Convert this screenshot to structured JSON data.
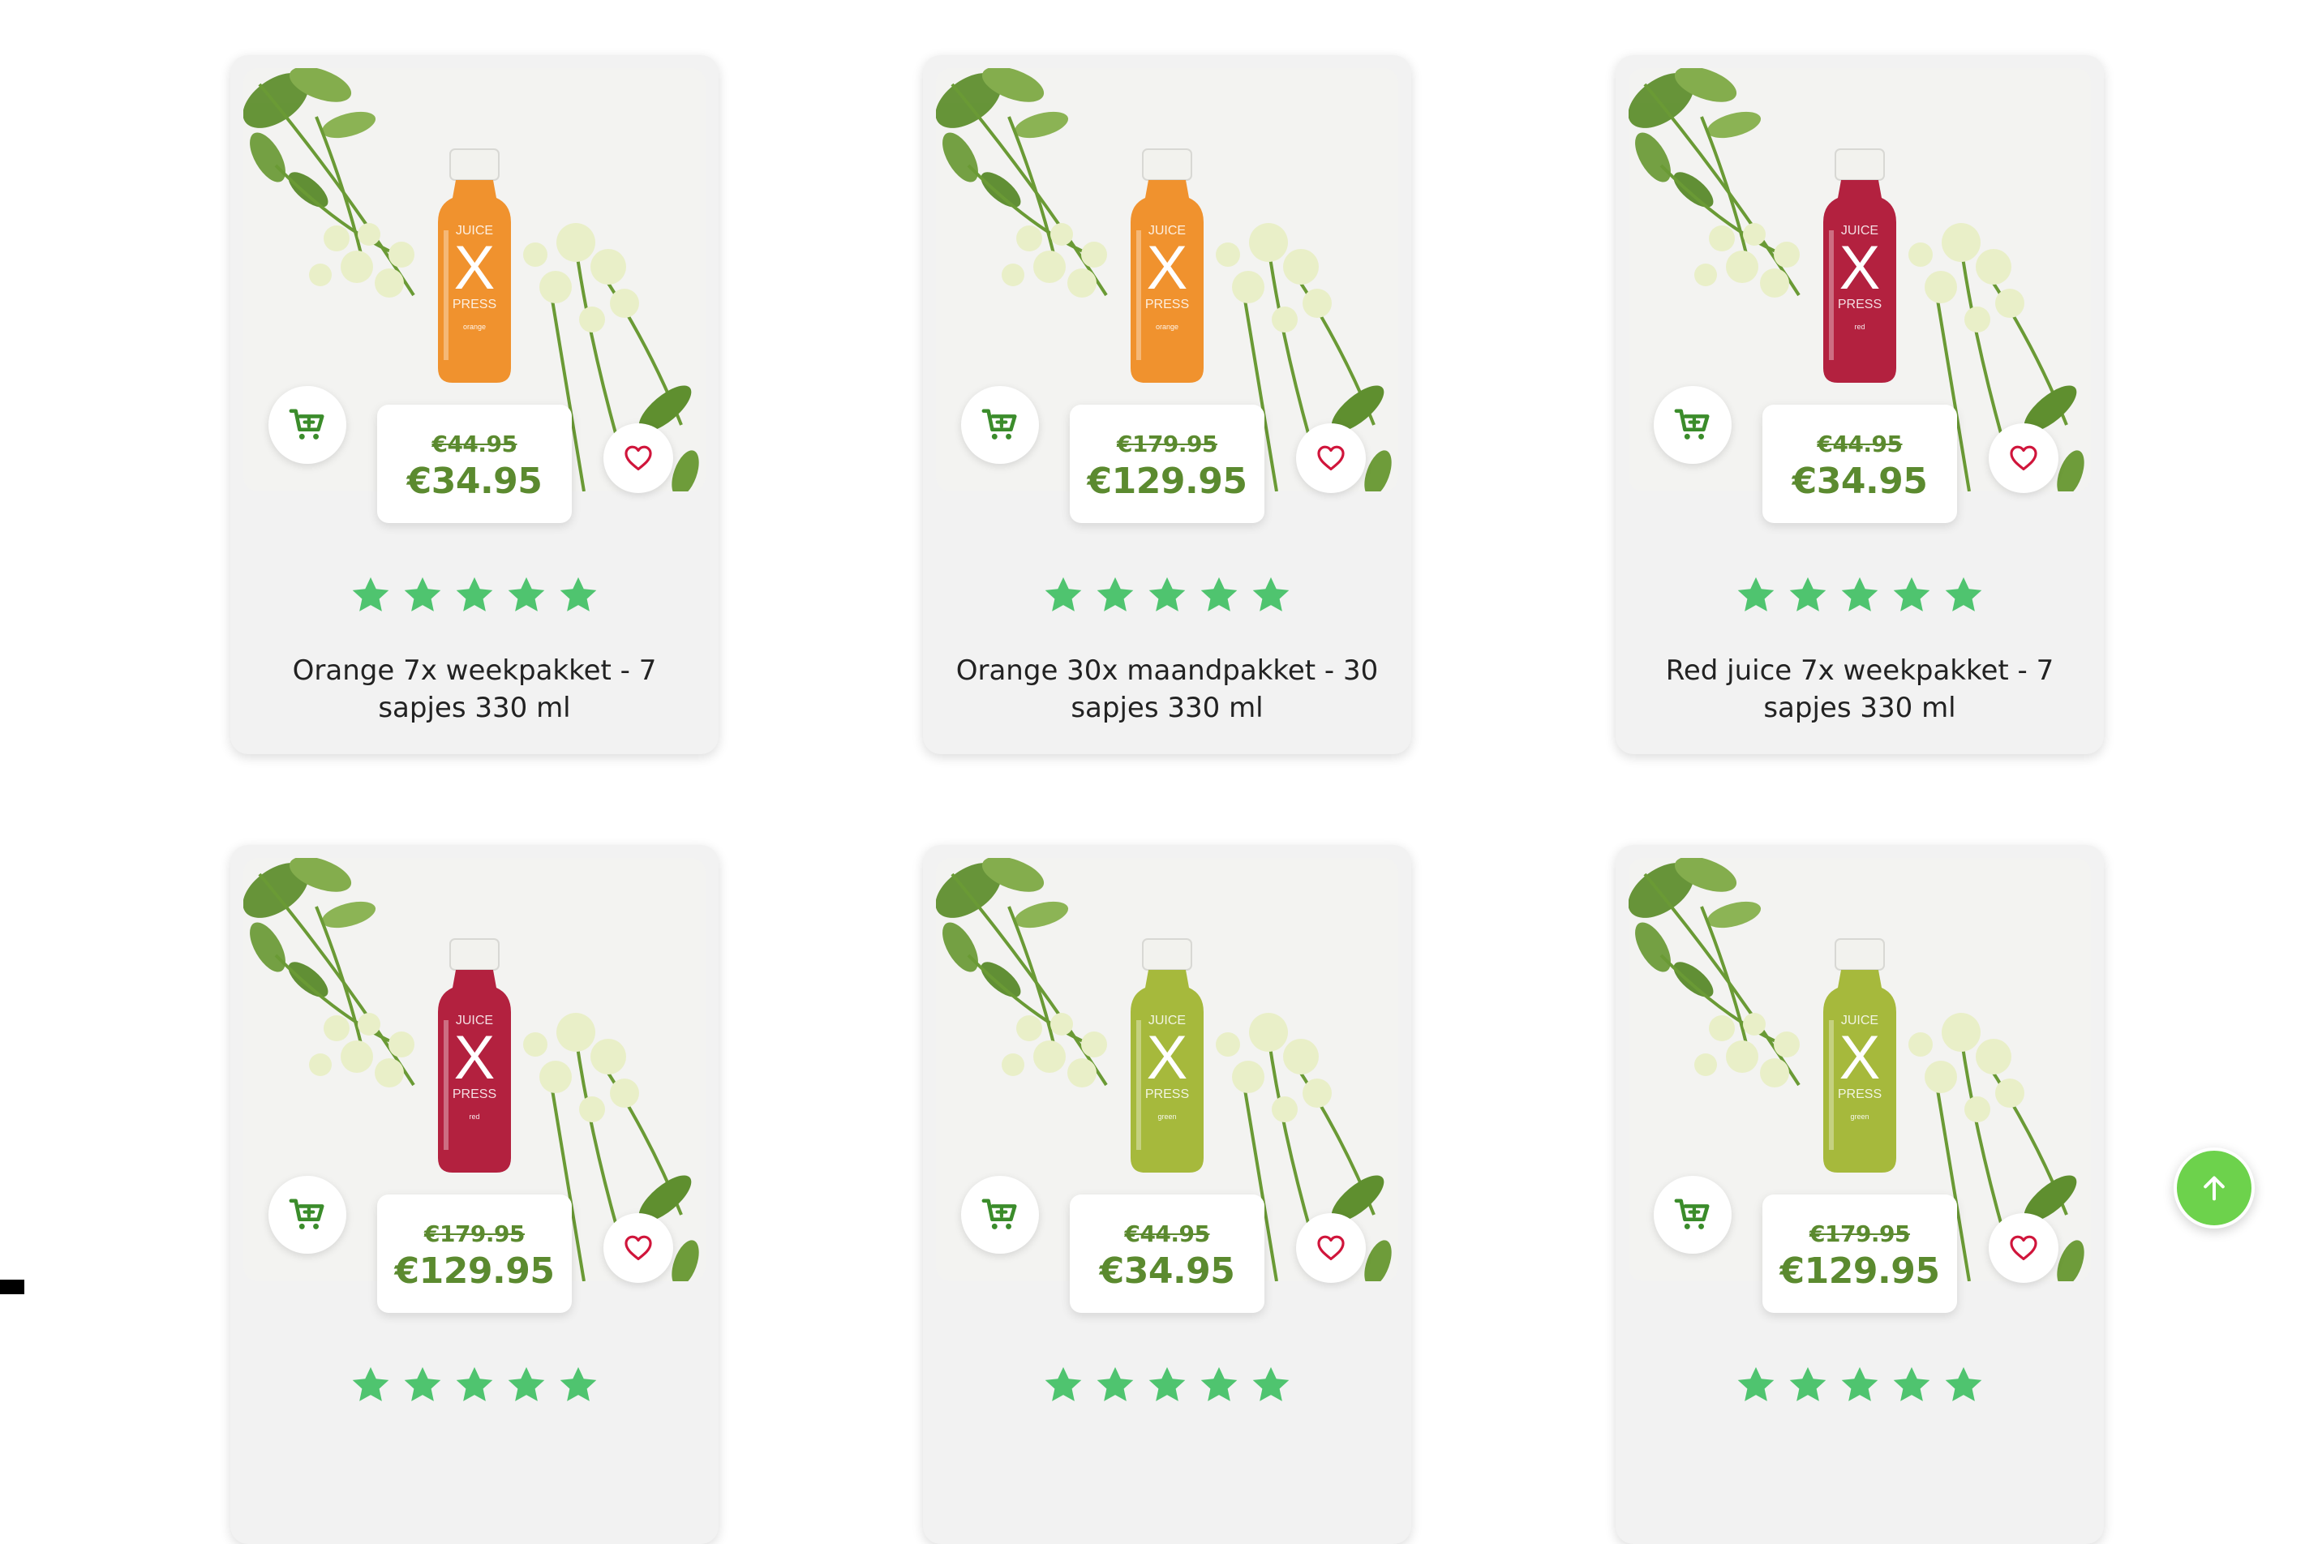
{
  "colors": {
    "price": "#5b8a2f",
    "star": "#4fc46f",
    "heart": "#d0153b",
    "cart": "#3b8c2b",
    "back_to_top": "#6dd24c"
  },
  "icons": {
    "cart": "cart-plus-icon",
    "favorite": "heart-outline-icon",
    "rating": "star-icon",
    "back_to_top": "arrow-up-icon"
  },
  "bottle_brand": [
    "JUICE",
    "X",
    "PRESS"
  ],
  "products": [
    {
      "title": "Orange 7x weekpakket - 7 sapjes 330 ml",
      "old_price": "€44.95",
      "price": "€34.95",
      "rating": 5,
      "juice_color": "#f0922e",
      "flavor": "orange"
    },
    {
      "title": "Orange 30x maandpakket - 30 sapjes 330 ml",
      "old_price": "€179.95",
      "price": "€129.95",
      "rating": 5,
      "juice_color": "#f0922e",
      "flavor": "orange"
    },
    {
      "title": "Red juice 7x weekpakket - 7 sapjes 330 ml",
      "old_price": "€44.95",
      "price": "€34.95",
      "rating": 5,
      "juice_color": "#b3213f",
      "flavor": "red"
    },
    {
      "title": "",
      "old_price": "€179.95",
      "price": "€129.95",
      "rating": 5,
      "juice_color": "#b3213f",
      "flavor": "red"
    },
    {
      "title": "",
      "old_price": "€44.95",
      "price": "€34.95",
      "rating": 5,
      "juice_color": "#a6b93c",
      "flavor": "green"
    },
    {
      "title": "",
      "old_price": "€179.95",
      "price": "€129.95",
      "rating": 5,
      "juice_color": "#a6b93c",
      "flavor": "green"
    }
  ]
}
